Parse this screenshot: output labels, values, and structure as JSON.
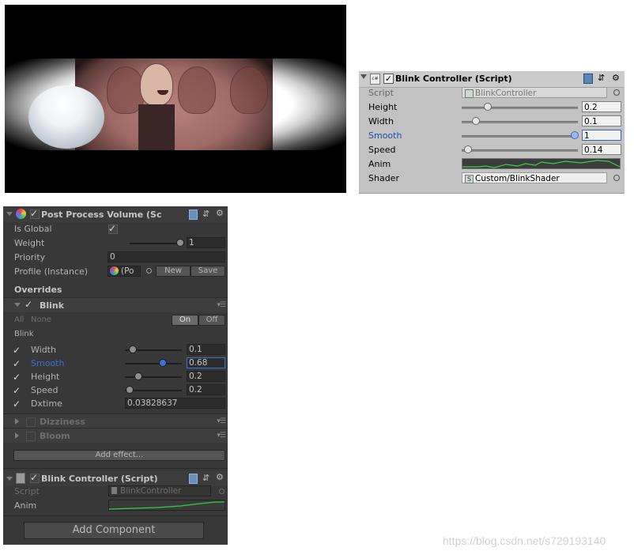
{
  "light_inspector": {
    "title": "Blink Controller (Script)",
    "icon": "script-icon",
    "rows": {
      "script": {
        "label": "Script",
        "value": "BlinkController"
      },
      "height": {
        "label": "Height",
        "value": "0.2",
        "slider": 0.2
      },
      "width": {
        "label": "Width",
        "value": "0.1",
        "slider": 0.1
      },
      "smooth": {
        "label": "Smooth",
        "value": "1",
        "slider": 1.0
      },
      "speed": {
        "label": "Speed",
        "value": "0.14",
        "slider": 0.05
      },
      "anim": {
        "label": "Anim"
      },
      "shader": {
        "label": "Shader",
        "value": "Custom/BlinkShader",
        "badge": "S"
      }
    }
  },
  "post_process": {
    "title": "Post Process Volume (Sc",
    "is_global": {
      "label": "Is Global",
      "checked": true
    },
    "weight": {
      "label": "Weight",
      "value": "1",
      "slider": 1.0
    },
    "priority": {
      "label": "Priority",
      "value": "0"
    },
    "profile": {
      "label": "Profile (Instance)",
      "value": "(Po",
      "new_label": "New",
      "save_label": "Save"
    },
    "overrides_label": "Overrides",
    "blink": {
      "title": "Blink",
      "all_label": "All",
      "none_label": "None",
      "on_label": "On",
      "off_label": "Off",
      "sub_label": "Blink",
      "width": {
        "label": "Width",
        "value": "0.1",
        "slider": 0.1
      },
      "smooth": {
        "label": "Smooth",
        "value": "0.68",
        "slider": 0.68
      },
      "height": {
        "label": "Height",
        "value": "0.2",
        "slider": 0.2
      },
      "speed": {
        "label": "Speed",
        "value": "0.2",
        "slider": 0.05
      },
      "dxtime": {
        "label": "Dxtime",
        "value": "0.03828637"
      }
    },
    "dizziness": {
      "title": "Dizziness"
    },
    "bloom": {
      "title": "Bloom"
    },
    "add_effect_label": "Add effect..."
  },
  "dark_blink_controller": {
    "title": "Blink Controller (Script)",
    "script": {
      "label": "Script",
      "value": "BlinkController"
    },
    "anim": {
      "label": "Anim"
    }
  },
  "add_component_label": "Add Component",
  "watermark": "https://blog.csdn.net/s729193140",
  "colors": {
    "accent_blue": "#3d6fd6",
    "curve_green": "#2fd14a"
  }
}
